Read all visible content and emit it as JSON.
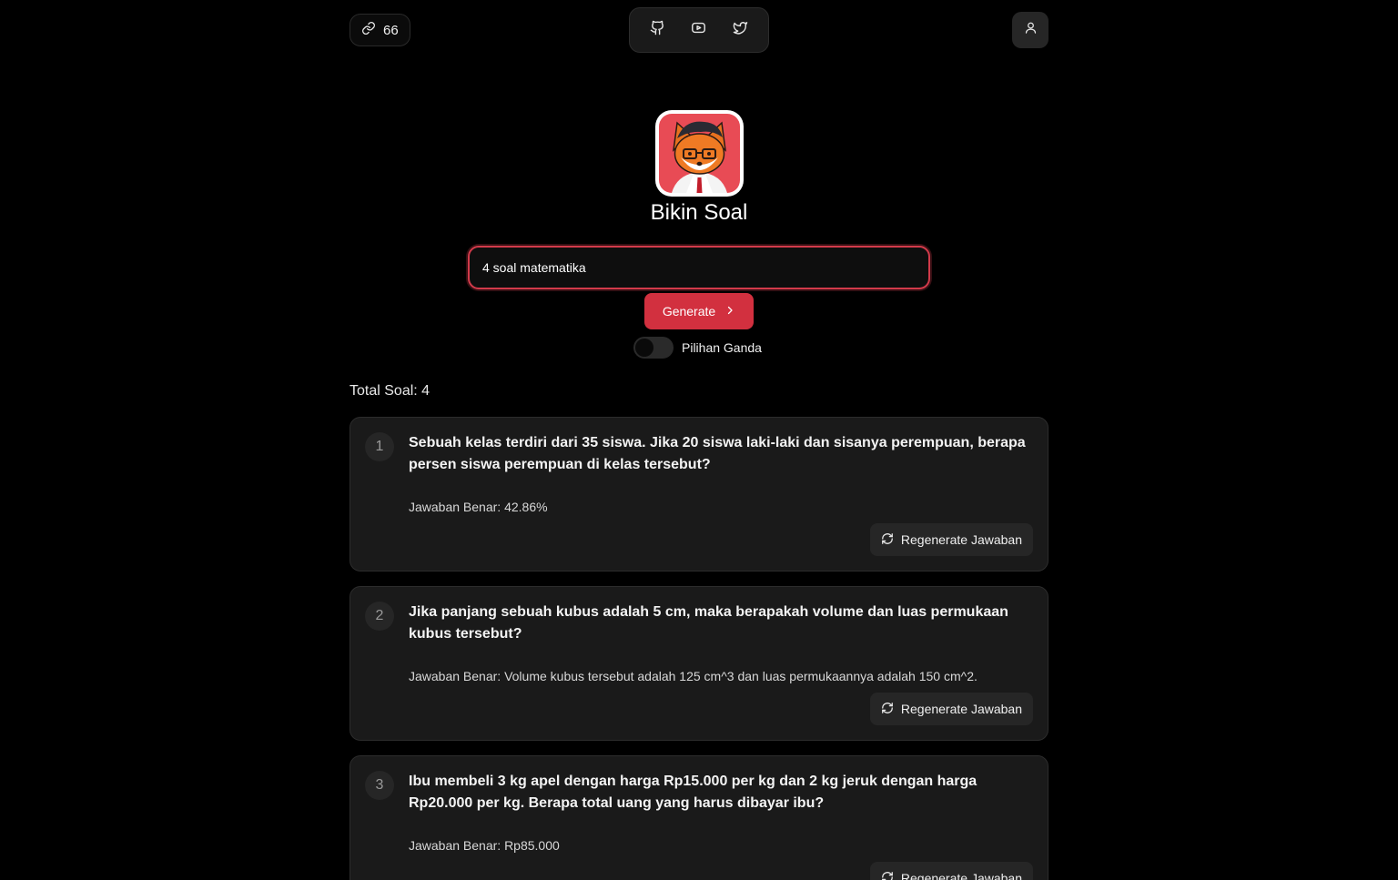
{
  "header": {
    "credits_count": "66",
    "credits_icon": "link-icon",
    "social_icons": [
      "github-icon",
      "youtube-icon",
      "twitter-icon"
    ],
    "user_icon": "user-icon"
  },
  "app": {
    "title": "Bikin Soal",
    "logo": "fox-mascot-logo"
  },
  "form": {
    "prompt_value": "4 soal matematika",
    "generate_label": "Generate",
    "toggle_label": "Pilihan Ganda",
    "toggle_on": false
  },
  "summary": {
    "total_label": "Total Soal: 4"
  },
  "questions": [
    {
      "number": "1",
      "text": "Sebuah kelas terdiri dari 35 siswa. Jika 20 siswa laki-laki dan sisanya perempuan, berapa persen siswa perempuan di kelas tersebut?",
      "answer": "Jawaban Benar: 42.86%",
      "regen_label": "Regenerate Jawaban"
    },
    {
      "number": "2",
      "text": "Jika panjang sebuah kubus adalah 5 cm, maka berapakah volume dan luas permukaan kubus tersebut?",
      "answer": "Jawaban Benar: Volume kubus tersebut adalah 125 cm^3 dan luas permukaannya adalah 150 cm^2.",
      "regen_label": "Regenerate Jawaban"
    },
    {
      "number": "3",
      "text": "Ibu membeli 3 kg apel dengan harga Rp15.000 per kg dan 2 kg jeruk dengan harga Rp20.000 per kg. Berapa total uang yang harus dibayar ibu?",
      "answer": "Jawaban Benar: Rp85.000",
      "regen_label": "Regenerate Jawaban"
    }
  ],
  "colors": {
    "background": "#000000",
    "card": "#1a1a1a",
    "accent": "#d2303f"
  }
}
